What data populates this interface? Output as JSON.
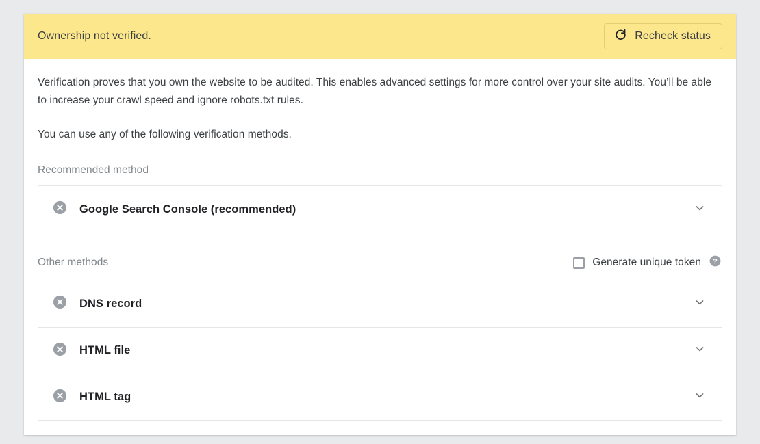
{
  "banner": {
    "message": "Ownership not verified.",
    "recheck_label": "Recheck status",
    "recheck_icon": "refresh-icon",
    "background_color": "#fce78d"
  },
  "body": {
    "paragraph_1": "Verification proves that you own the website to be audited. This enables advanced settings for more control over your site audits. You’ll be able to increase your crawl speed and ignore robots.txt rules.",
    "paragraph_2": "You can use any of the following verification methods.",
    "recommended_label": "Recommended method",
    "other_label": "Other methods"
  },
  "token_option": {
    "label": "Generate unique token",
    "checked": false,
    "help_icon": "help-circle-icon"
  },
  "recommended_methods": [
    {
      "label": "Google Search Console (recommended)",
      "status_icon": "x-circle-icon",
      "expand_icon": "chevron-down-icon"
    }
  ],
  "other_methods": [
    {
      "label": "DNS record",
      "status_icon": "x-circle-icon",
      "expand_icon": "chevron-down-icon"
    },
    {
      "label": "HTML file",
      "status_icon": "x-circle-icon",
      "expand_icon": "chevron-down-icon"
    },
    {
      "label": "HTML tag",
      "status_icon": "x-circle-icon",
      "expand_icon": "chevron-down-icon"
    }
  ],
  "colors": {
    "page_background": "#e9eaeb",
    "banner": "#fce78d",
    "status_icon": "#9aa0a6",
    "text_primary": "#3c4043",
    "text_muted": "#80868b"
  }
}
